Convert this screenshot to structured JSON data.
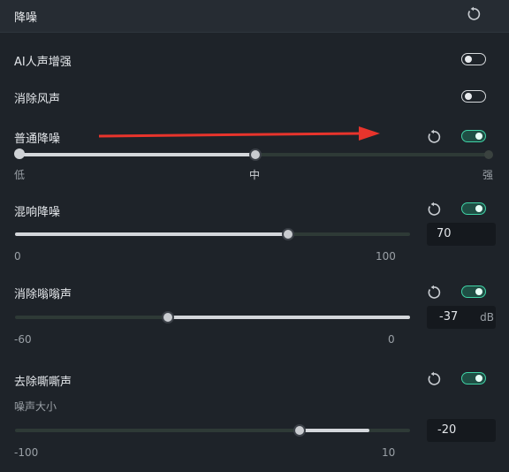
{
  "header": {
    "title": "降噪",
    "reset_icon": "reset-icon"
  },
  "ai_voice": {
    "label": "AI人声增强",
    "enabled": false
  },
  "wind": {
    "label": "消除风声",
    "enabled": false
  },
  "normal_denoise": {
    "label": "普通降噪",
    "enabled": true,
    "low_label": "低",
    "mid_label": "中",
    "high_label": "强",
    "level": "中"
  },
  "reverb": {
    "label": "混响降噪",
    "enabled": true,
    "value": "70",
    "min_label": "0",
    "max_label": "100"
  },
  "hum": {
    "label": "消除嗡嗡声",
    "enabled": true,
    "value": "-37",
    "unit": "dB",
    "min_label": "-60",
    "max_label": "0"
  },
  "hiss": {
    "label": "去除嘶嘶声",
    "enabled": true,
    "sub_label": "噪声大小",
    "value": "-20",
    "min_label": "-100",
    "max_label": "10"
  },
  "colors": {
    "accent": "#3fd3a6",
    "arrow": "#e8342c",
    "background": "#1e2329"
  }
}
